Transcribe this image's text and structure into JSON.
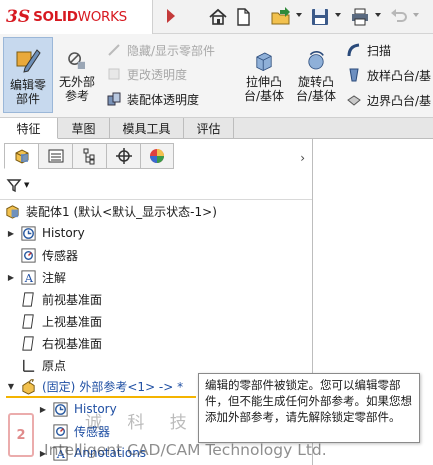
{
  "app": {
    "logo_mark": "3S",
    "logo_name_bold": "SOLID",
    "logo_name_rest": "WORKS"
  },
  "ribbon": {
    "edit_component": [
      "编辑零",
      "部件"
    ],
    "no_external_refs": [
      "无外部",
      "参考"
    ],
    "hide_show_components": "隐藏/显示零部件",
    "change_transparency": "更改透明度",
    "assembly_transparency": "装配体透明度",
    "extrude_boss": [
      "拉伸凸",
      "台/基体"
    ],
    "revolve_boss": [
      "旋转凸",
      "台/基体"
    ],
    "sweep": "扫描",
    "loft_boss": "放样凸台/基",
    "boundary_boss": "边界凸台/基"
  },
  "tabs": [
    "特征",
    "草图",
    "模具工具",
    "评估"
  ],
  "feature_tree": {
    "more_glyph": "›",
    "root": "装配体1 (默认<默认_显示状态-1>)",
    "items": [
      {
        "label": "History"
      },
      {
        "label": "传感器"
      },
      {
        "label": "注解"
      },
      {
        "label": "前视基准面"
      },
      {
        "label": "上视基准面"
      },
      {
        "label": "右视基准面"
      },
      {
        "label": "原点"
      }
    ],
    "part_prefix": "(固定)",
    "part_label": "外部参考<1> -> *",
    "sub_items": [
      {
        "label": "History"
      },
      {
        "label": "传感器"
      },
      {
        "label": "Annotations"
      }
    ]
  },
  "tooltip": {
    "text": "编辑的零部件被锁定。您可以编辑零部件，但不能生成任何外部参考。如果您想添加外部参考，请先解除锁定零部件。"
  },
  "watermark": {
    "logo": "2",
    "cn": "诚 科 技",
    "en": "Intelligent CAD/CAM Technology Ltd."
  },
  "colors": {
    "accent_red": "#d71920",
    "selection_bg": "#c7d9ee",
    "highlight_underline": "#f4b400",
    "link_blue": "#1f4fa3"
  }
}
